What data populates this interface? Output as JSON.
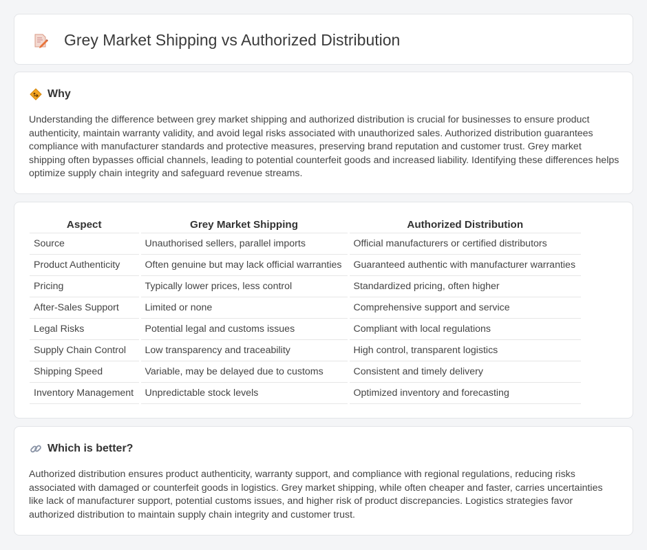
{
  "header": {
    "title": "Grey Market Shipping vs Authorized Distribution",
    "icon": "document-pencil-icon"
  },
  "why": {
    "heading": "Why",
    "icon": "diamond-sign-icon",
    "text": "Understanding the difference between grey market shipping and authorized distribution is crucial for businesses to ensure product authenticity, maintain warranty validity, and avoid legal risks associated with unauthorized sales. Authorized distribution guarantees compliance with manufacturer standards and protective measures, preserving brand reputation and customer trust. Grey market shipping often bypasses official channels, leading to potential counterfeit goods and increased liability. Identifying these differences helps optimize supply chain integrity and safeguard revenue streams."
  },
  "table": {
    "headers": [
      "Aspect",
      "Grey Market Shipping",
      "Authorized Distribution"
    ],
    "rows": [
      [
        "Source",
        "Unauthorised sellers, parallel imports",
        "Official manufacturers or certified distributors"
      ],
      [
        "Product Authenticity",
        "Often genuine but may lack official warranties",
        "Guaranteed authentic with manufacturer warranties"
      ],
      [
        "Pricing",
        "Typically lower prices, less control",
        "Standardized pricing, often higher"
      ],
      [
        "After-Sales Support",
        "Limited or none",
        "Comprehensive support and service"
      ],
      [
        "Legal Risks",
        "Potential legal and customs issues",
        "Compliant with local regulations"
      ],
      [
        "Supply Chain Control",
        "Low transparency and traceability",
        "High control, transparent logistics"
      ],
      [
        "Shipping Speed",
        "Variable, may be delayed due to customs",
        "Consistent and timely delivery"
      ],
      [
        "Inventory Management",
        "Unpredictable stock levels",
        "Optimized inventory and forecasting"
      ]
    ]
  },
  "better": {
    "heading": "Which is better?",
    "icon": "link-icon",
    "text": "Authorized distribution ensures product authenticity, warranty support, and compliance with regional regulations, reducing risks associated with damaged or counterfeit goods in logistics. Grey market shipping, while often cheaper and faster, carries uncertainties like lack of manufacturer support, potential customs issues, and higher risk of product discrepancies. Logistics strategies favor authorized distribution to maintain supply chain integrity and customer trust."
  }
}
